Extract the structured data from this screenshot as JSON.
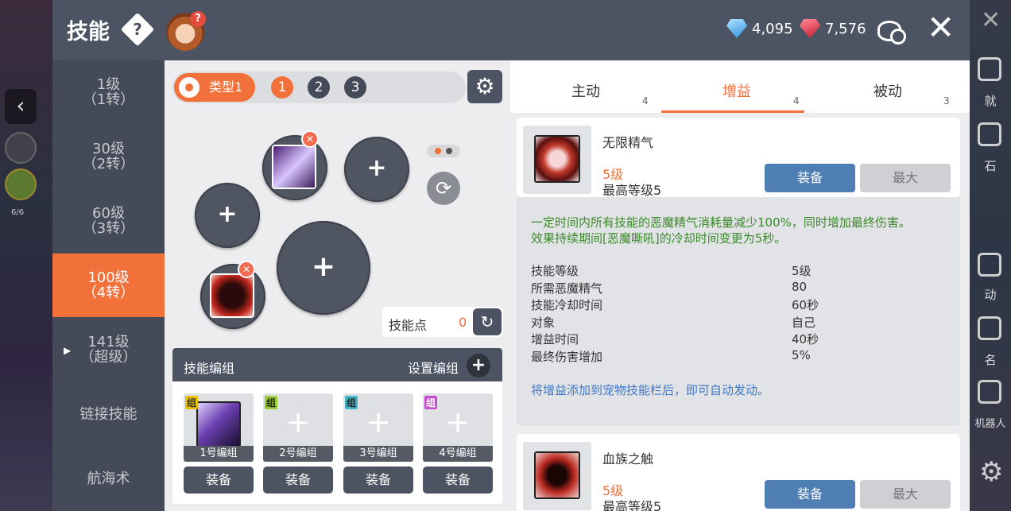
{
  "header": {
    "title": "技能",
    "blue_gems": "4,095",
    "red_gems": "7,576"
  },
  "nav": {
    "items": [
      {
        "line1": "1级",
        "line2": "（1转）"
      },
      {
        "line1": "30级",
        "line2": "（2转）"
      },
      {
        "line1": "60级",
        "line2": "（3转）"
      },
      {
        "line1": "100级",
        "line2": "（4转）"
      },
      {
        "line1": "141级",
        "line2": "（超级）"
      },
      {
        "line1": "链接技能",
        "line2": ""
      },
      {
        "line1": "航海术",
        "line2": ""
      }
    ],
    "active_index": 3
  },
  "presets": {
    "type_label": "类型1",
    "numbers": [
      "1",
      "2",
      "3"
    ],
    "active_number": "1"
  },
  "skill_points": {
    "label": "技能点",
    "value": "0"
  },
  "groups": {
    "title": "技能编组",
    "set_label": "设置编组",
    "tag": "组",
    "cards": [
      {
        "label": "1号编组",
        "equip": "装备",
        "tag_color": "#e6c200"
      },
      {
        "label": "2号编组",
        "equip": "装备",
        "tag_color": "#9acd32"
      },
      {
        "label": "3号编组",
        "equip": "装备",
        "tag_color": "#3fb6c8"
      },
      {
        "label": "4号编组",
        "equip": "装备",
        "tag_color": "#c44ccf"
      }
    ]
  },
  "tabs": [
    {
      "label": "主动",
      "count": "4"
    },
    {
      "label": "增益",
      "count": "4"
    },
    {
      "label": "被动",
      "count": "3"
    }
  ],
  "active_tab": 1,
  "skills": [
    {
      "name": "无限精气",
      "level": "5级",
      "max_level": "最高等级5",
      "equip": "装备",
      "max": "最大"
    },
    {
      "name": "血族之触",
      "level": "5级",
      "max_level": "最高等级5",
      "equip": "装备",
      "max": "最大"
    }
  ],
  "detail": {
    "description_line1": "一定时间内所有技能的恶魔精气消耗量减少100%，同时增加最终伤害。",
    "description_line2": "效果持续期间[恶魔嘶吼]的冷却时间变更为5秒。",
    "stats": [
      {
        "k": "技能等级",
        "v": "5级"
      },
      {
        "k": "所需恶魔精气",
        "v": "80"
      },
      {
        "k": "技能冷却时间",
        "v": "60秒"
      },
      {
        "k": "对象",
        "v": "自己"
      },
      {
        "k": "增益时间",
        "v": "40秒"
      },
      {
        "k": "最终伤害增加",
        "v": "5%"
      }
    ],
    "note": "将增益添加到宠物技能栏后，即可自动发动。"
  },
  "background": {
    "right_labels": [
      "就",
      "石",
      "动",
      "名",
      "机器人"
    ],
    "left_counter": "6/6"
  },
  "colors": {
    "accent": "#f2703a",
    "panel_dark": "#4c5362",
    "equip_blue": "#4f7eb5",
    "desc_green": "#3a8a2a",
    "note_blue": "#3f78c6"
  }
}
